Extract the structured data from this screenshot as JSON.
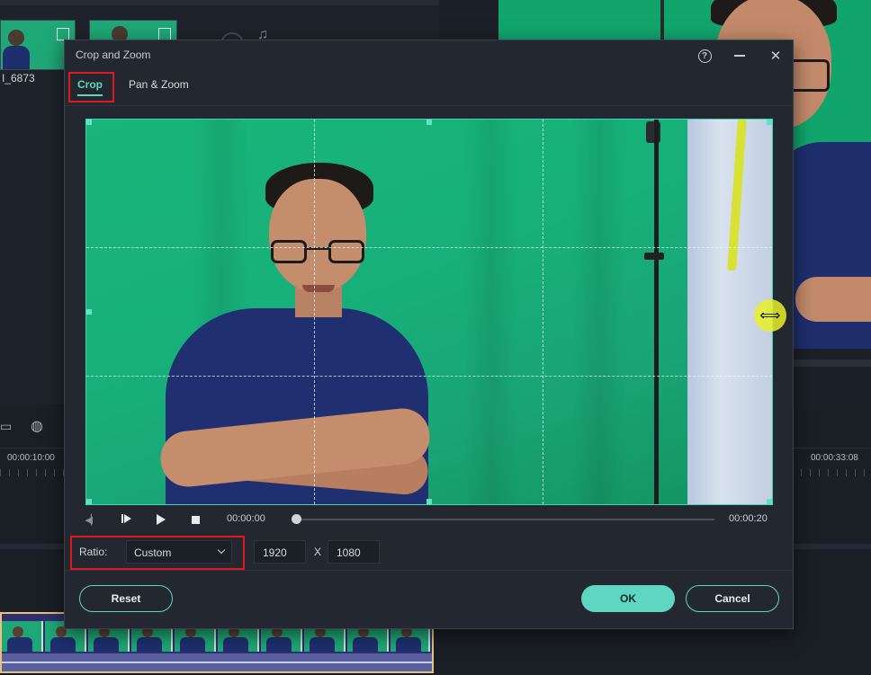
{
  "background": {
    "media_clip_label": "I_6873",
    "timecode_left": "00:00:10:00",
    "timecode_right": "00:00:33:08"
  },
  "dialog": {
    "title": "Crop and Zoom",
    "tabs": [
      {
        "label": "Crop",
        "active": true
      },
      {
        "label": "Pan & Zoom",
        "active": false
      }
    ],
    "playback": {
      "current_time": "00:00:00",
      "total_time": "00:00:20",
      "progress": 0.0
    },
    "ratio": {
      "label": "Ratio:",
      "selected": "Custom",
      "width": "1920",
      "separator": "X",
      "height": "1080"
    },
    "buttons": {
      "reset": "Reset",
      "ok": "OK",
      "cancel": "Cancel"
    },
    "icons": {
      "help": "help-icon",
      "minimize": "minimize-icon",
      "close": "close-icon"
    },
    "colors": {
      "accent": "#5fd6c2",
      "highlight_box": "#e0191f",
      "cursor_highlight": "#e8f028"
    }
  }
}
